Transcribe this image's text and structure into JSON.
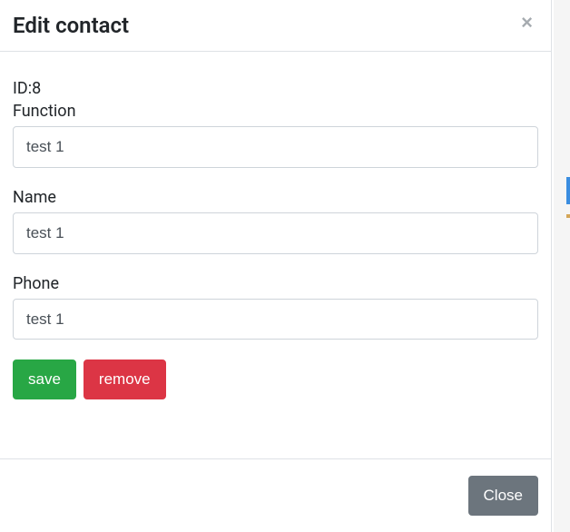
{
  "modal": {
    "title": "Edit contact",
    "close_aria": "Close"
  },
  "form": {
    "id_label": "ID:",
    "id_value": "8",
    "function_label": "Function",
    "function_value": "test 1",
    "name_label": "Name",
    "name_value": "test 1",
    "phone_label": "Phone",
    "phone_value": "test 1"
  },
  "buttons": {
    "save": "save",
    "remove": "remove",
    "close": "Close"
  }
}
